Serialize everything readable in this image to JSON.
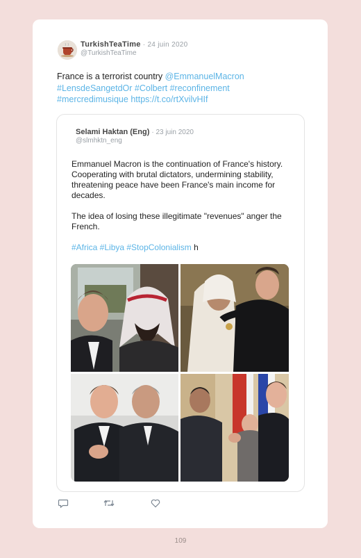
{
  "tweet": {
    "author_name": "TurkishTeaTime",
    "date": "· 24 juin 2020",
    "handle": "@TurkishTeaTime",
    "text_plain": "France is a terrorist country ",
    "mention": "@EmmanuelMacron",
    "hashtags_line1": "#LensdeSangetdOr #Colbert #reconfinement",
    "hashtags_line2": "#mercredimusique",
    "link": "https://t.co/rtXvilvHIf"
  },
  "quoted": {
    "author_name": "Selami Haktan (Eng)",
    "date": "· 23 juin 2020",
    "handle": "@slmhktn_eng",
    "paragraph1": "Emmanuel Macron is the continuation of France's history. Cooperating with brutal dictators, undermining stability, threatening peace have been France's main income for decades.",
    "paragraph2": "The idea of losing these illegitimate \"revenues\" anger the French.",
    "hashtags": "#Africa #Libya #StopColonialism",
    "trailing": " h"
  },
  "actions": {
    "reply_icon": "reply-icon",
    "retweet_icon": "retweet-icon",
    "like_icon": "heart-icon"
  },
  "page_number": "109"
}
